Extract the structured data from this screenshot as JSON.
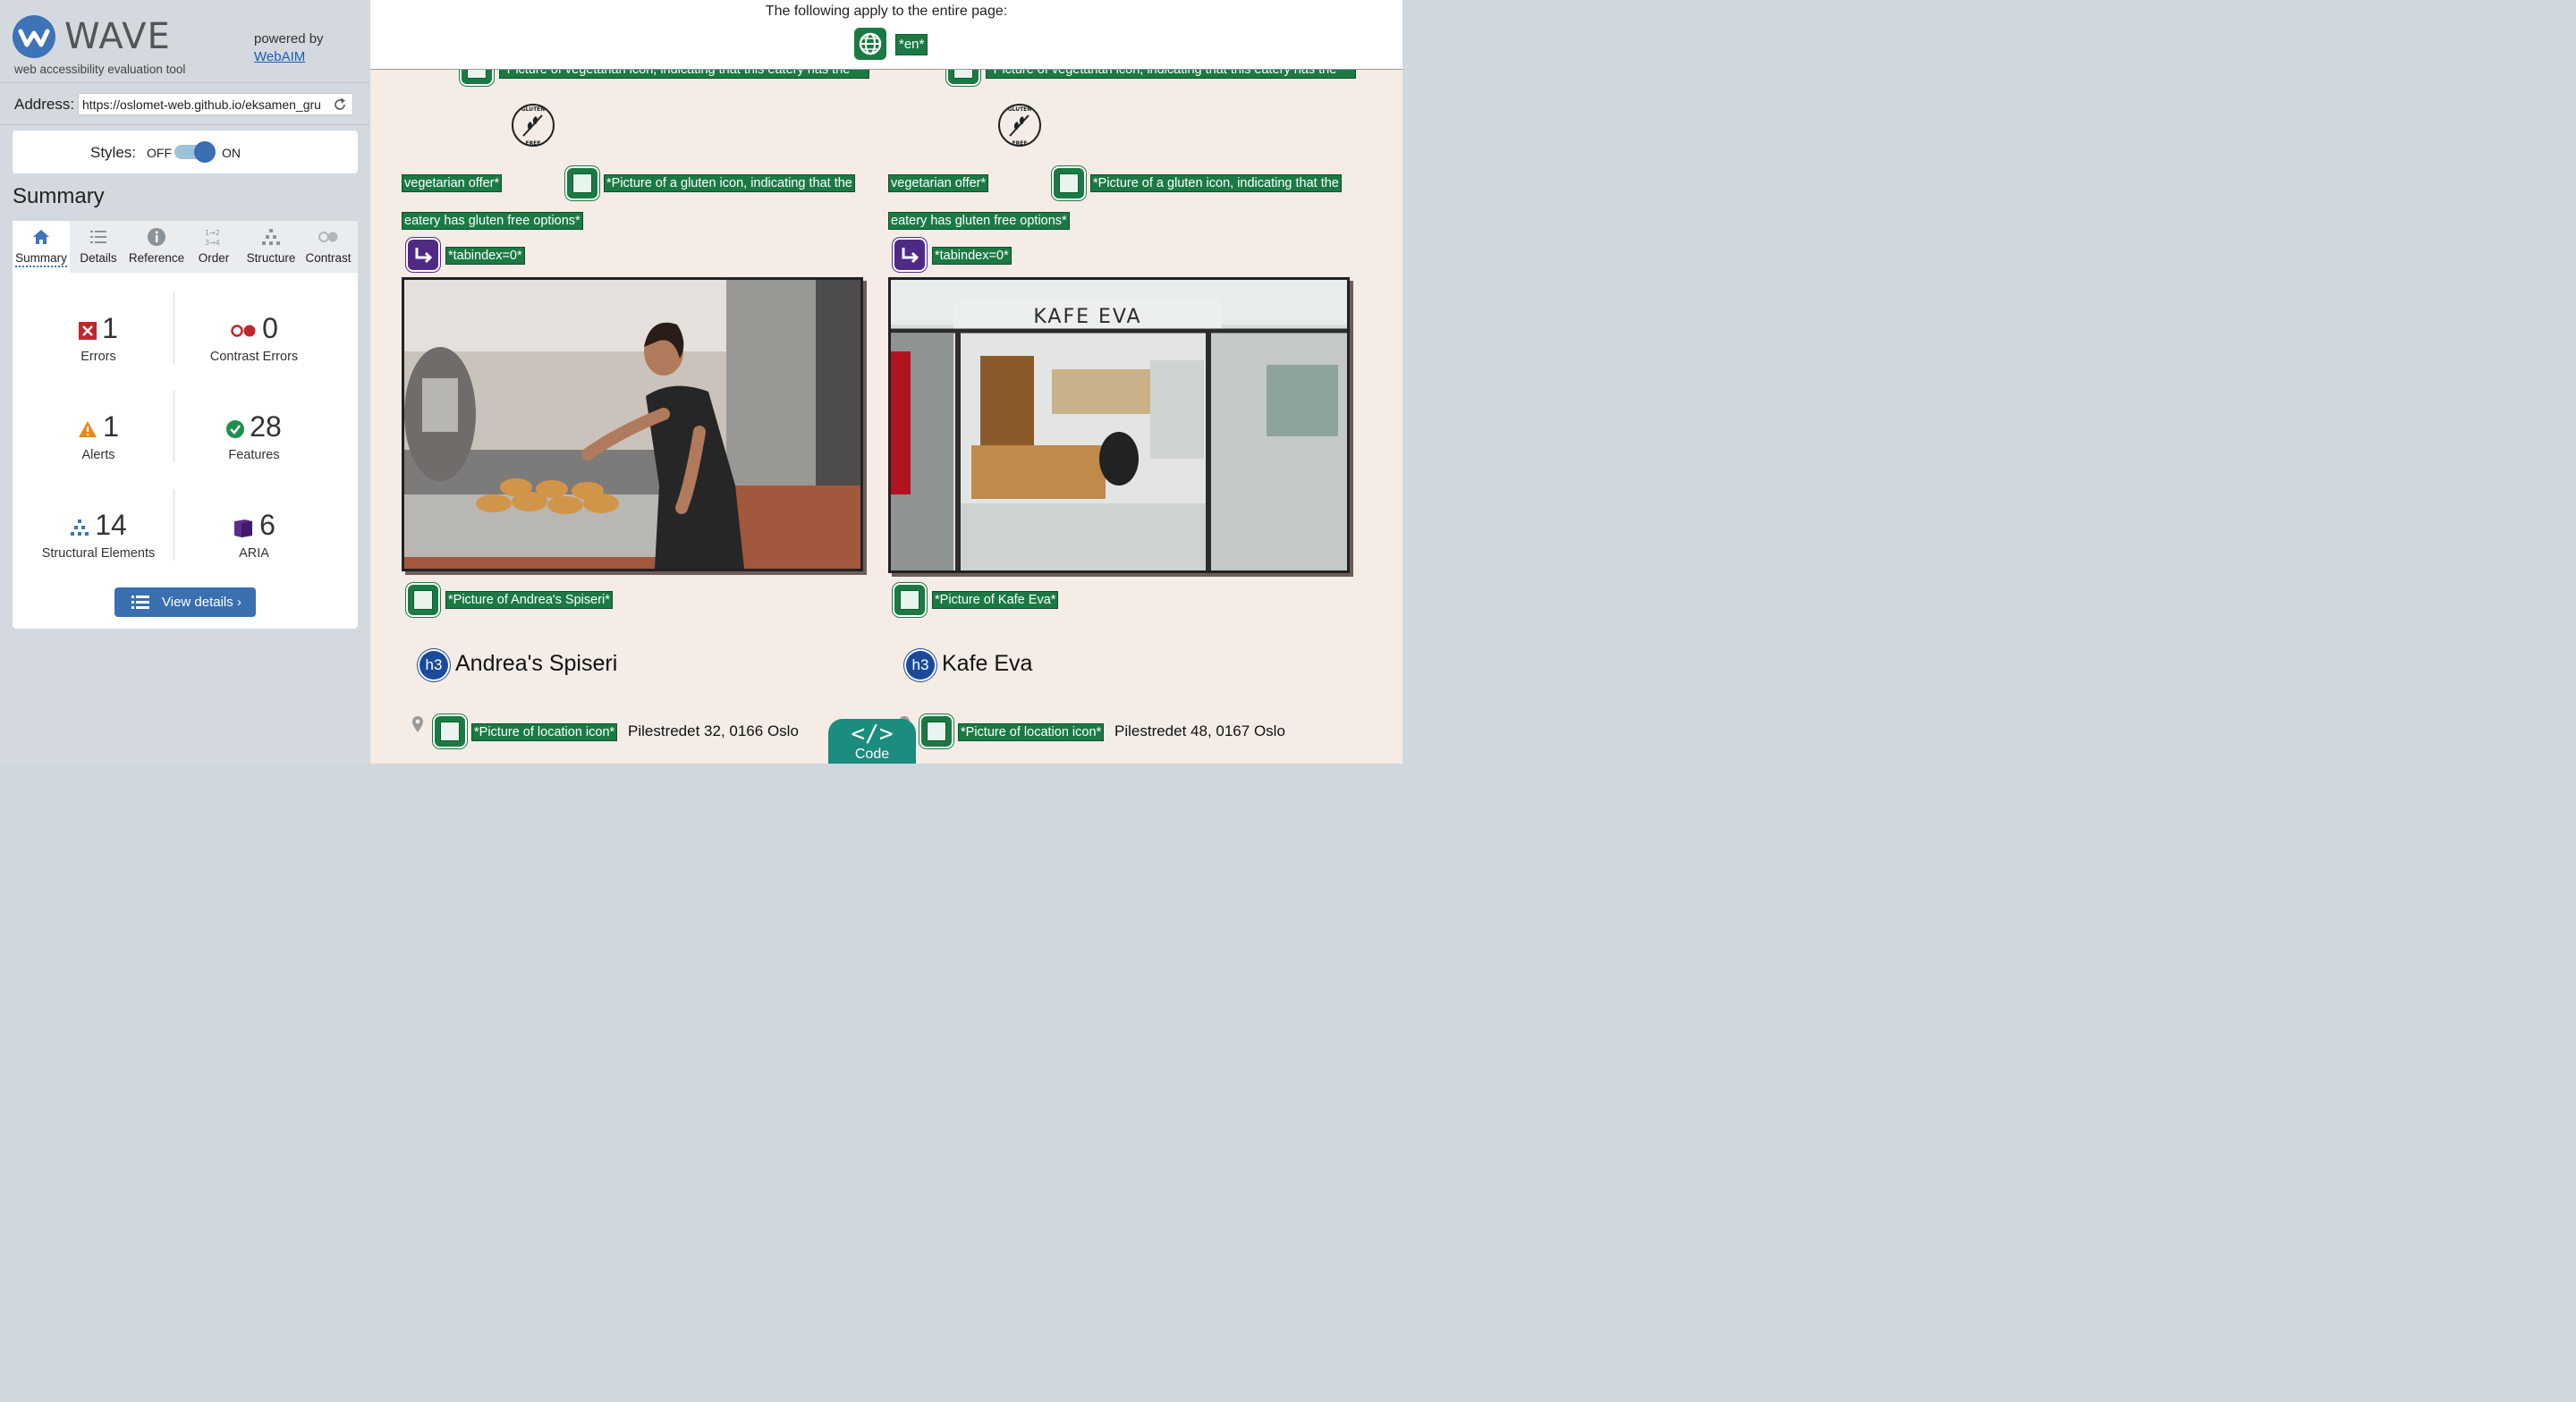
{
  "sidebar": {
    "logo_text": "WAVE",
    "logo_subtitle": "web accessibility evaluation tool",
    "powered_by": "powered by",
    "powered_link": "WebAIM",
    "address_label": "Address:",
    "address_value": "https://oslomet-web.github.io/eksamen_gru",
    "styles_label": "Styles:",
    "styles_off": "OFF",
    "styles_on": "ON",
    "summary_title": "Summary",
    "tabs": [
      {
        "label": "Summary",
        "icon": "home-icon"
      },
      {
        "label": "Details",
        "icon": "list-icon"
      },
      {
        "label": "Reference",
        "icon": "info-icon"
      },
      {
        "label": "Order",
        "icon": "order-icon"
      },
      {
        "label": "Structure",
        "icon": "structure-icon"
      },
      {
        "label": "Contrast",
        "icon": "contrast-icon"
      }
    ],
    "stats": {
      "errors": {
        "value": "1",
        "label": "Errors"
      },
      "contrast_errors": {
        "value": "0",
        "label": "Contrast Errors"
      },
      "alerts": {
        "value": "1",
        "label": "Alerts"
      },
      "features": {
        "value": "28",
        "label": "Features"
      },
      "structural": {
        "value": "14",
        "label": "Structural Elements"
      },
      "aria": {
        "value": "6",
        "label": "ARIA"
      }
    },
    "view_details": "View details ›",
    "colors": {
      "accent": "#3a6fb0",
      "error": "#c0262d",
      "alert": "#e88a17",
      "feature": "#1f8f4e",
      "aria": "#5b2d8e"
    }
  },
  "page": {
    "top_notice": "The following apply to the entire page:",
    "lang_tag": "*en*",
    "cutoff_tag": "*Picture of vegetarian icon, indicating that this eatery has the",
    "col1": {
      "veg_tag": "vegetarian offer*",
      "gluten_tag_1": "*Picture of a gluten icon, indicating that the",
      "gluten_tag_2": "eatery has gluten free options*",
      "tabindex_tag": "*tabindex=0*",
      "photo_tag": "*Picture of Andrea's Spiseri*",
      "heading_badge": "h3",
      "heading": "Andrea's Spiseri",
      "location_tag": "*Picture of location icon*",
      "address": "Pilestredet 32, 0166 Oslo"
    },
    "col2": {
      "veg_tag": "vegetarian offer*",
      "gluten_tag_1": "*Picture of a gluten icon, indicating that the",
      "gluten_tag_2": "eatery has gluten free options*",
      "tabindex_tag": "*tabindex=0*",
      "photo_tag": "*Picture of Kafe Eva*",
      "heading_badge": "h3",
      "heading": "Kafe Eva",
      "location_tag": "*Picture of location icon*",
      "address": "Pilestredet 48, 0167 Oslo",
      "storefront_sign": "KAFE EVA"
    },
    "code_button": {
      "symbol": "</>",
      "label": "Code"
    },
    "gluten_badge": {
      "top": "GLUTEN",
      "bottom": "FREE"
    }
  }
}
